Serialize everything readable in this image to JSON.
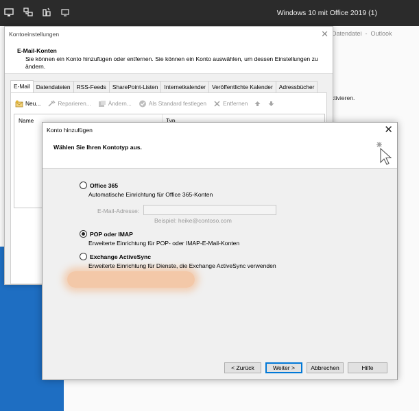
{
  "vm": {
    "title": "Windows 10 mit Office 2019 (1)",
    "icons": [
      "monitor-icon",
      "network-icon",
      "settings-icon",
      "display-icon"
    ]
  },
  "outlook": {
    "title": "Datendatei  -  Outlook",
    "body_text": "ktivieren."
  },
  "account_settings": {
    "title": "Kontoeinstellungen",
    "header_title": "E-Mail-Konten",
    "header_desc": "Sie können ein Konto hinzufügen oder entfernen. Sie können ein Konto auswählen, um dessen Einstellungen zu ändern.",
    "tabs": [
      {
        "label": "E-Mail",
        "active": true
      },
      {
        "label": "Datendateien",
        "active": false
      },
      {
        "label": "RSS-Feeds",
        "active": false
      },
      {
        "label": "SharePoint-Listen",
        "active": false
      },
      {
        "label": "Internetkalender",
        "active": false
      },
      {
        "label": "Veröffentlichte Kalender",
        "active": false
      },
      {
        "label": "Adressbücher",
        "active": false
      }
    ],
    "toolbar": {
      "new": "Neu...",
      "repair": "Reparieren...",
      "change": "Ändern...",
      "set_default": "Als Standard festlegen",
      "remove": "Entfernen"
    },
    "columns": {
      "name": "Name",
      "type": "Typ"
    }
  },
  "add_account": {
    "title": "Konto hinzufügen",
    "header_title": "Wählen Sie Ihren Kontotyp aus.",
    "office365": {
      "label": "Office 365",
      "desc": "Automatische Einrichtung für Office 365-Konten",
      "email_label": "E-Mail-Adresse:",
      "email_value": "",
      "example": "Beispiel: heike@contoso.com"
    },
    "pop_imap": {
      "label": "POP oder IMAP",
      "desc": "Erweiterte Einrichtung für POP- oder IMAP-E-Mail-Konten",
      "selected": true
    },
    "exchange": {
      "label": "Exchange ActiveSync",
      "desc": "Erweiterte Einrichtung für Dienste, die Exchange ActiveSync verwenden"
    },
    "buttons": {
      "back": "< Zurück",
      "next": "Weiter >",
      "cancel": "Abbrechen",
      "help": "Hilfe"
    }
  },
  "colors": {
    "vm_bar": "#2b2b2b",
    "outlook_blue": "#1e6ec2",
    "highlight": "#f5a86e",
    "dialog_bg": "#f0f0f0"
  }
}
